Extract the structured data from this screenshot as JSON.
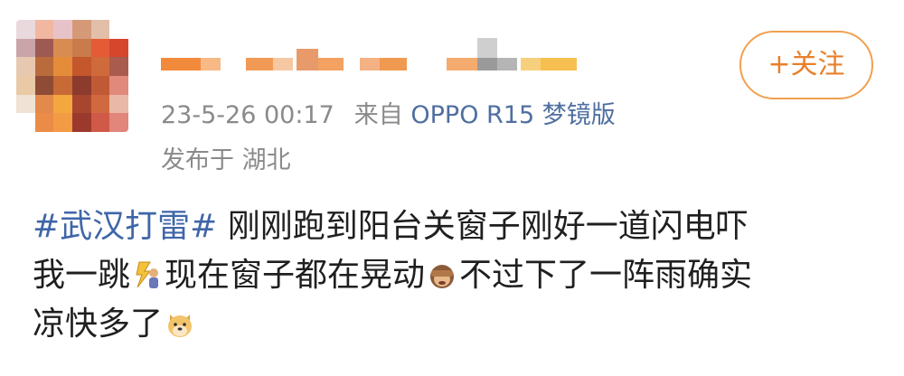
{
  "post": {
    "timestamp": "23-5-26 00:17",
    "source_prefix": "来自",
    "device": "OPPO R15 梦镜版",
    "location": "发布于 湖北",
    "follow_label": "+关注",
    "hashtag": "#武汉打雷#",
    "text_1": " 刚刚跑到阳台关窗子刚好一道闪电吓",
    "text_2": "我一跳",
    "text_3": "现在窗子都在晃动",
    "text_4": "不过下了一阵雨确实",
    "text_5": "凉快多了",
    "emojis": [
      "lightning-person-icon",
      "see-no-evil-monkey-icon",
      "doge-icon"
    ]
  },
  "colors": {
    "link": "#3f66a8",
    "meta": "#8a8a8a",
    "follow_accent": "#e8802a"
  }
}
